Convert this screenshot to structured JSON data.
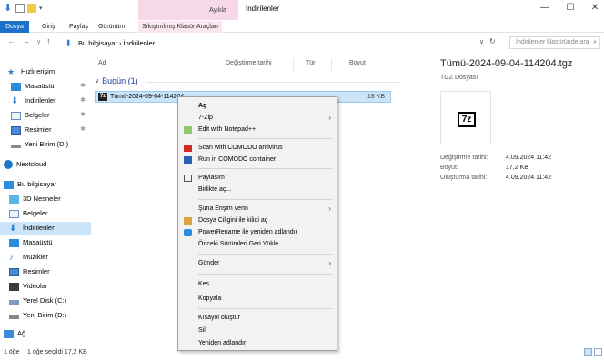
{
  "window": {
    "title": "İndirilenler",
    "context_group": "Ayıkla",
    "controls": [
      "—",
      "☐",
      "✕"
    ]
  },
  "ribbon": {
    "tabs": [
      "Dosya",
      "Giriş",
      "Paylaş",
      "Görünüm",
      "Sıkıştırılmış Klasör Araçları"
    ]
  },
  "address": {
    "path": "Bu bilgisayar  ›  İndirilenler",
    "search_placeholder": "İndirilenler klasöründe ara"
  },
  "nav": {
    "items": [
      {
        "label": "Hızlı erişim",
        "icon": "star-icon",
        "pinned": false
      },
      {
        "label": "Masaüstü",
        "icon": "desktop-icon",
        "pinned": true
      },
      {
        "label": "İndirilenler",
        "icon": "download-icon",
        "pinned": true
      },
      {
        "label": "Belgeler",
        "icon": "document-icon",
        "pinned": true
      },
      {
        "label": "Resimler",
        "icon": "pictures-icon",
        "pinned": true
      },
      {
        "label": "Yeni Birim (D:)",
        "icon": "drive-icon",
        "pinned": false
      },
      {
        "label": "Nextcloud",
        "icon": "cloud-icon",
        "pinned": false
      },
      {
        "label": "Bu bilgisayar",
        "icon": "computer-icon",
        "pinned": false
      },
      {
        "label": "3D Nesneler",
        "icon": "cube-icon",
        "pinned": false
      },
      {
        "label": "Belgeler",
        "icon": "document-icon",
        "pinned": false
      },
      {
        "label": "İndirilenler",
        "icon": "download-icon",
        "pinned": false
      },
      {
        "label": "Masaüstü",
        "icon": "desktop-icon",
        "pinned": false
      },
      {
        "label": "Müzikler",
        "icon": "music-icon",
        "pinned": false
      },
      {
        "label": "Resimler",
        "icon": "pictures-icon",
        "pinned": false
      },
      {
        "label": "Videolar",
        "icon": "video-icon",
        "pinned": false
      },
      {
        "label": "Yerel Disk (C:)",
        "icon": "disk-icon",
        "pinned": false
      },
      {
        "label": "Yeni Birim (D:)",
        "icon": "drive-icon",
        "pinned": false
      },
      {
        "label": "Ağ",
        "icon": "network-icon",
        "pinned": false
      }
    ]
  },
  "list": {
    "columns": [
      "Ad",
      "Değiştirme tarihi",
      "Tür",
      "Boyut"
    ],
    "group": "Bugün (1)",
    "file": {
      "name": "Tümü-2024-09-04-114204",
      "size": "18 KB",
      "icon_text": "7z"
    }
  },
  "details": {
    "title": "Tümü-2024-09-04-114204.tgz",
    "type": "TGZ Dosyası",
    "icon_text": "7z",
    "props": [
      {
        "label": "Değiştirme tarihi:",
        "value": "4.09.2024 11:42"
      },
      {
        "label": "Boyut:",
        "value": "17,2 KB"
      },
      {
        "label": "Oluşturma tarihi:",
        "value": "4.09.2024 11:42"
      }
    ]
  },
  "status": {
    "count": "1 öğe",
    "selection": "1 öğe seçildi  17,2 KB"
  },
  "menu": {
    "items": [
      {
        "label": "Aç",
        "bold": true
      },
      {
        "label": "7-Zip",
        "submenu": true
      },
      {
        "label": "Edit with Notepad++",
        "icon": "notepad-icon"
      },
      {
        "label": "Scan with COMODO antivirus",
        "icon": "comodo-scan-icon"
      },
      {
        "label": "Run in COMODO container",
        "icon": "comodo-container-icon"
      },
      {
        "label": "Paylaşım",
        "icon": "share-icon"
      },
      {
        "label": "Birlikte aç..."
      },
      {
        "label": "Şuna Erişim verin",
        "submenu": true
      },
      {
        "label": "Dosya Ciligini ile kilidi aç",
        "icon": "lock-icon"
      },
      {
        "label": "PowerRename ile yeniden adlandır",
        "icon": "powerrename-icon"
      },
      {
        "label": "Önceki Sürümleri Geri Yükle"
      },
      {
        "label": "Gönder",
        "submenu": true
      },
      {
        "label": "Kes"
      },
      {
        "label": "Kopyala"
      },
      {
        "label": "Kısayol oluştur"
      },
      {
        "label": "Sil"
      },
      {
        "label": "Yeniden adlandır"
      }
    ]
  }
}
